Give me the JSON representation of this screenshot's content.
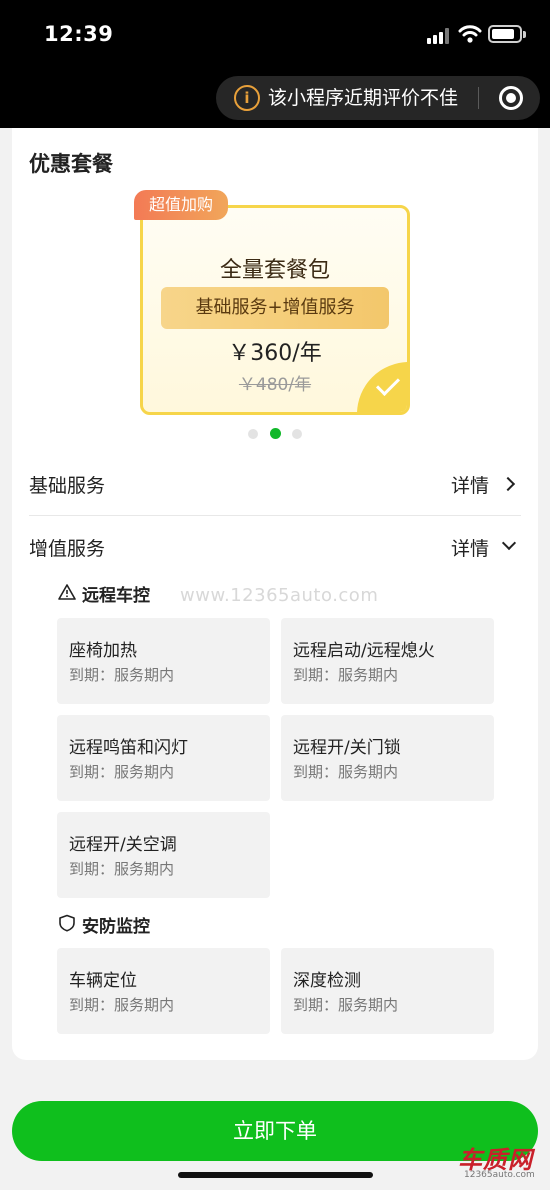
{
  "status_bar": {
    "time": "12:39"
  },
  "header": {
    "rating_notice": "该小程序近期评价不佳"
  },
  "packages": {
    "section_title": "优惠套餐",
    "badge": "超值加购",
    "name": "全量套餐包",
    "includes": "基础服务+增值服务",
    "price": "￥360/年",
    "original_price": "￥480/年",
    "carousel_active_index": 1,
    "carousel_count": 3
  },
  "basic_service": {
    "label": "基础服务",
    "detail_label": "详情"
  },
  "value_added_service": {
    "label": "增值服务",
    "detail_label": "详情"
  },
  "remote_control": {
    "title": "远程车控",
    "items": [
      {
        "name": "座椅加热",
        "expiry": "到期：服务期内"
      },
      {
        "name": "远程启动/远程熄火",
        "expiry": "到期：服务期内"
      },
      {
        "name": "远程鸣笛和闪灯",
        "expiry": "到期：服务期内"
      },
      {
        "name": "远程开/关门锁",
        "expiry": "到期：服务期内"
      },
      {
        "name": "远程开/关空调",
        "expiry": "到期：服务期内"
      }
    ]
  },
  "security_monitoring": {
    "title": "安防监控",
    "items": [
      {
        "name": "车辆定位",
        "expiry": "到期：服务期内"
      },
      {
        "name": "深度检测",
        "expiry": "到期：服务期内"
      }
    ]
  },
  "watermark": "www.12365auto.com",
  "order_button": "立即下单",
  "logo": {
    "name": "车质网",
    "url": "12365auto.com"
  },
  "colors": {
    "primary_green": "#0fbf1d",
    "gold": "#f6d54a",
    "badge_orange": "#f37a55",
    "warning": "#e8a03a"
  }
}
